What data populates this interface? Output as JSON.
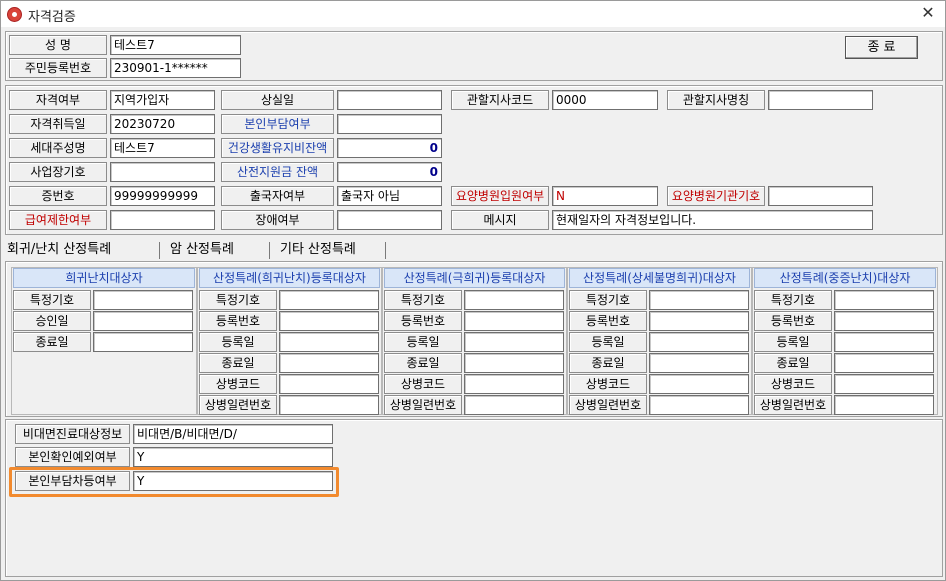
{
  "window": {
    "title": "자격검증",
    "close_symbol": "✕"
  },
  "header": {
    "name_label": "성 명",
    "name_value": "테스트7",
    "rrn_label": "주민등록번호",
    "rrn_value": "230901-1******",
    "close_button": "종 료"
  },
  "info": {
    "qual_label": "자격여부",
    "qual_value": "지역가입자",
    "loss_label": "상실일",
    "loss_value": "",
    "branch_code_label": "관할지사코드",
    "branch_code_value": "0000",
    "branch_name_label": "관할지사명칭",
    "branch_name_value": "",
    "acq_label": "자격취득일",
    "acq_value": "20230720",
    "copay_label": "본인부담여부",
    "copay_value": "",
    "head_label": "세대주성명",
    "head_value": "테스트7",
    "health_label": "건강생활유지비잔액",
    "health_value": "0",
    "biz_label": "사업장기호",
    "biz_value": "",
    "prenatal_label": "산전지원금 잔액",
    "prenatal_value": "0",
    "card_label": "증번호",
    "card_value": "99999999999",
    "departure_label": "출국자여부",
    "departure_value": "출국자 아님",
    "nursing_label": "요양병원입원여부",
    "nursing_value": "N",
    "nursing_code_label": "요양병원기관기호",
    "nursing_code_value": "",
    "limit_label": "급여제한여부",
    "limit_value": "",
    "disability_label": "장애여부",
    "disability_value": "",
    "message_label": "메시지",
    "message_value": "현재일자의 자격정보입니다."
  },
  "tabs": [
    "회귀/난치 산정특례",
    "암 산정특례",
    "기타 산정특례"
  ],
  "columns": [
    {
      "title": "희귀난치대상자",
      "rows": [
        "특정기호",
        "승인일",
        "종료일"
      ]
    },
    {
      "title": "산정특례(희귀난치)등록대상자",
      "rows": [
        "특정기호",
        "등록번호",
        "등록일",
        "종료일",
        "상병코드",
        "상병일련번호"
      ]
    },
    {
      "title": "산정특례(극희귀)등록대상자",
      "rows": [
        "특정기호",
        "등록번호",
        "등록일",
        "종료일",
        "상병코드",
        "상병일련번호"
      ]
    },
    {
      "title": "산정특례(상세불명희귀)대상자",
      "rows": [
        "특정기호",
        "등록번호",
        "등록일",
        "종료일",
        "상병코드",
        "상병일련번호"
      ]
    },
    {
      "title": "산정특례(중증난치)대상자",
      "rows": [
        "특정기호",
        "등록번호",
        "등록일",
        "종료일",
        "상병코드",
        "상병일련번호"
      ]
    }
  ],
  "bottom": {
    "telemed_label": "비대면진료대상정보",
    "telemed_value": "비대면/B/비대면/D/",
    "selfcheck_label": "본인확인예외여부",
    "selfcheck_value": "Y",
    "copay_diff_label": "본인부담차등여부",
    "copay_diff_value": "Y"
  },
  "colors": {
    "highlight": "#f28a2e",
    "blue_label": "#1b3fae",
    "red_label": "#c00000"
  }
}
